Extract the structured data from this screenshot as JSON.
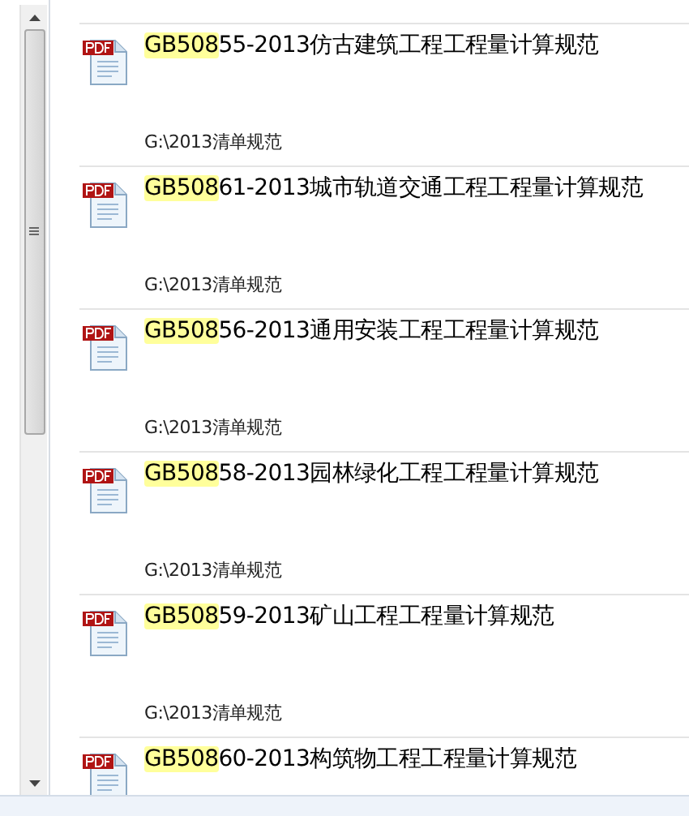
{
  "results": [
    {
      "match": "GB508",
      "rest": "55-2013仿古建筑工程工程量计算规范",
      "path": "G:\\2013清单规范"
    },
    {
      "match": "GB508",
      "rest": "61-2013城市轨道交通工程工程量计算规范",
      "path": "G:\\2013清单规范"
    },
    {
      "match": "GB508",
      "rest": "56-2013通用安装工程工程量计算规范",
      "path": "G:\\2013清单规范"
    },
    {
      "match": "GB508",
      "rest": "58-2013园林绿化工程工程量计算规范",
      "path": "G:\\2013清单规范"
    },
    {
      "match": "GB508",
      "rest": "59-2013矿山工程工程量计算规范",
      "path": "G:\\2013清单规范"
    },
    {
      "match": "GB508",
      "rest": "60-2013构筑物工程工程量计算规范"
    }
  ]
}
